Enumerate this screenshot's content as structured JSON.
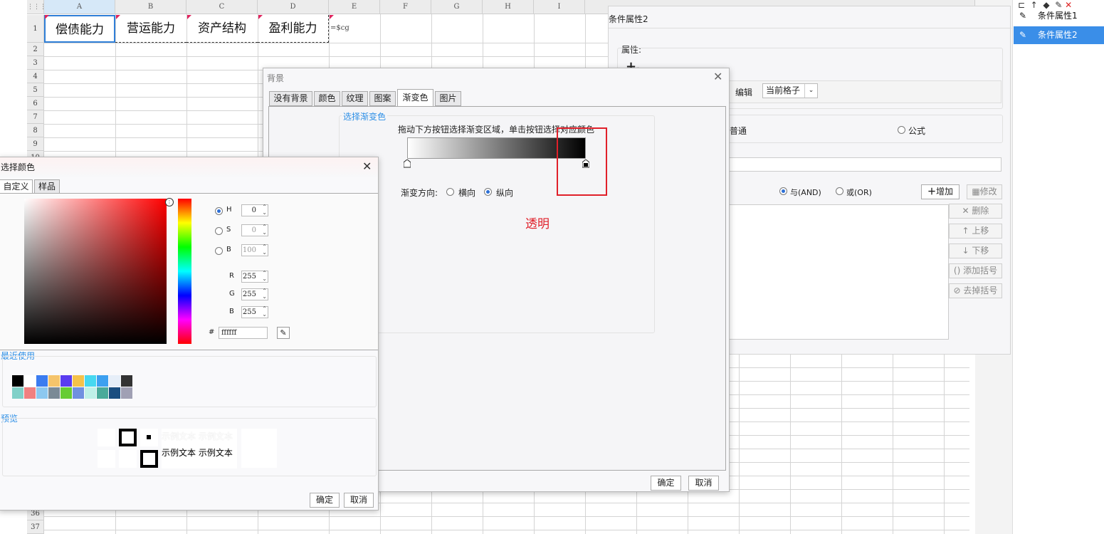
{
  "sheet": {
    "columns": [
      "A",
      "B",
      "C",
      "D",
      "E",
      "F",
      "G",
      "H",
      "I"
    ],
    "rows": [
      "1",
      "2",
      "3",
      "4",
      "5",
      "6",
      "7",
      "8",
      "9",
      "10"
    ],
    "bottom_rows": [
      "36",
      "37"
    ],
    "row1_cells": [
      "偿债能力",
      "营运能力",
      "资产结构",
      "盈利能力"
    ],
    "e1_text": "=$cg"
  },
  "cond_panel": {
    "title": "条件属性2",
    "property_label": "属性:",
    "add_glyph": "+",
    "edit_label": "编辑",
    "scope_value": "当前格子",
    "normal_label": "普通",
    "formula_label": "公式",
    "and_label": "与(AND)",
    "or_label": "或(OR)",
    "add_btn": "增加",
    "modify_btn": "修改",
    "delete_btn": "删除",
    "up_btn": "上移",
    "down_btn": "下移",
    "add_paren_btn": "添加括号",
    "remove_paren_btn": "去掉括号"
  },
  "side_list": {
    "items": [
      "条件属性1",
      "条件属性2"
    ],
    "selected_index": 1
  },
  "bg_dialog": {
    "title": "背景",
    "tabs": [
      "没有背景",
      "颜色",
      "纹理",
      "图案",
      "渐变色",
      "图片"
    ],
    "active_tab": "渐变色",
    "group_label": "选择渐变色",
    "hint": "拖动下方按钮选择渐变区域，单击按钮选择对应颜色",
    "direction_label": "渐变方向:",
    "horizontal": "横向",
    "vertical": "纵向",
    "annotation": "透明",
    "ok": "确定",
    "cancel": "取消"
  },
  "color_dialog": {
    "title": "选择颜色",
    "tabs": [
      "自定义",
      "样品"
    ],
    "h_label": "H",
    "h_value": "0",
    "s_label": "S",
    "s_value": "0",
    "b_label": "B",
    "b_value": "100",
    "r_label": "R",
    "r_value": "255",
    "g_label": "G",
    "g_value": "255",
    "bb_label": "B",
    "bb_value": "255",
    "hash": "#",
    "hex": "ffffff",
    "recent_label": "最近使用",
    "recent_row1": [
      "#000000",
      "#ffffff",
      "#3b7cf0",
      "#f5c46b",
      "#5a3cf0",
      "#f5c24a",
      "#46d8f0",
      "#3da0f0",
      "#e6eef8",
      "#333333"
    ],
    "recent_row2": [
      "#80d0c8",
      "#f08080",
      "#8cc8f0",
      "#7a8a96",
      "#66cc33",
      "#7090e0",
      "#bff0e8",
      "#4aaa9a",
      "#1a4e80",
      "#a0a0b4"
    ],
    "preview_label": "预览",
    "sample_text": "示例文本",
    "ok": "确定",
    "cancel": "取消"
  },
  "colors": {
    "accent": "#2d8fe6",
    "selected_side": "#3a8ee8",
    "annotation": "#e0202a"
  }
}
